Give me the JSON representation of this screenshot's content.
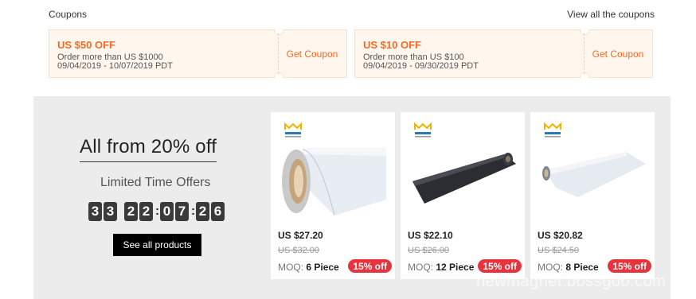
{
  "coupons": {
    "title": "Coupons",
    "view_all": "View all the coupons",
    "items": [
      {
        "amount": "US $50 OFF",
        "condition": "Order more than US $1000",
        "dates": "09/04/2019 - 10/07/2019 PDT",
        "action": "Get Coupon"
      },
      {
        "amount": "US $10 OFF",
        "condition": "Order more than US $100",
        "dates": "09/04/2019 - 09/30/2019 PDT",
        "action": "Get Coupon"
      }
    ]
  },
  "promo": {
    "title": "All from 20% off",
    "subtitle": "Limited Time Offers",
    "countdown": [
      "3",
      "3",
      "2",
      "2",
      "0",
      "7",
      "2",
      "6"
    ],
    "separator": ":",
    "see_all": "See all products"
  },
  "products": [
    {
      "price": "US $27.20",
      "old_price": "US $32.00",
      "moq_label": "MOQ:",
      "moq_value": "6 Piece",
      "discount": "15% off",
      "image": "white-magnetic-sheet-roll"
    },
    {
      "price": "US $22.10",
      "old_price": "US $26.00",
      "moq_label": "MOQ:",
      "moq_value": "12 Piece",
      "discount": "15% off",
      "image": "black-magnetic-sheet-roll"
    },
    {
      "price": "US $20.82",
      "old_price": "US $24.50",
      "moq_label": "MOQ:",
      "moq_value": "8 Piece",
      "discount": "15% off",
      "image": "white-magnetic-roll"
    }
  ],
  "watermark": "newmagnet.bossgoo.com",
  "colors": {
    "accent": "#f36a22",
    "badge": "#e8333c",
    "promo_bg": "#ececec"
  }
}
